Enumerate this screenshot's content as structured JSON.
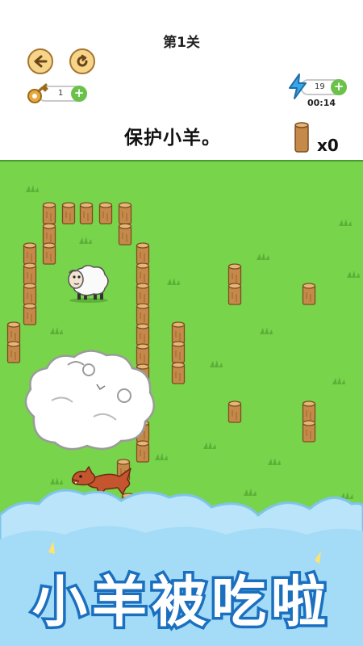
{
  "hud": {
    "level_title": "第1关",
    "back_icon": "arrow-left-icon",
    "restart_icon": "restart-icon",
    "keys": "1",
    "energy": "19",
    "timer": "00:14",
    "instruction": "保护小羊。",
    "logs_left": "x0"
  },
  "banner": {
    "text": "小羊被吃啦"
  },
  "colors": {
    "grass": "#78d44a",
    "stake": "#c58a4a",
    "banner_stroke": "#1a6fbf",
    "cloud": "#b9e4fa"
  }
}
